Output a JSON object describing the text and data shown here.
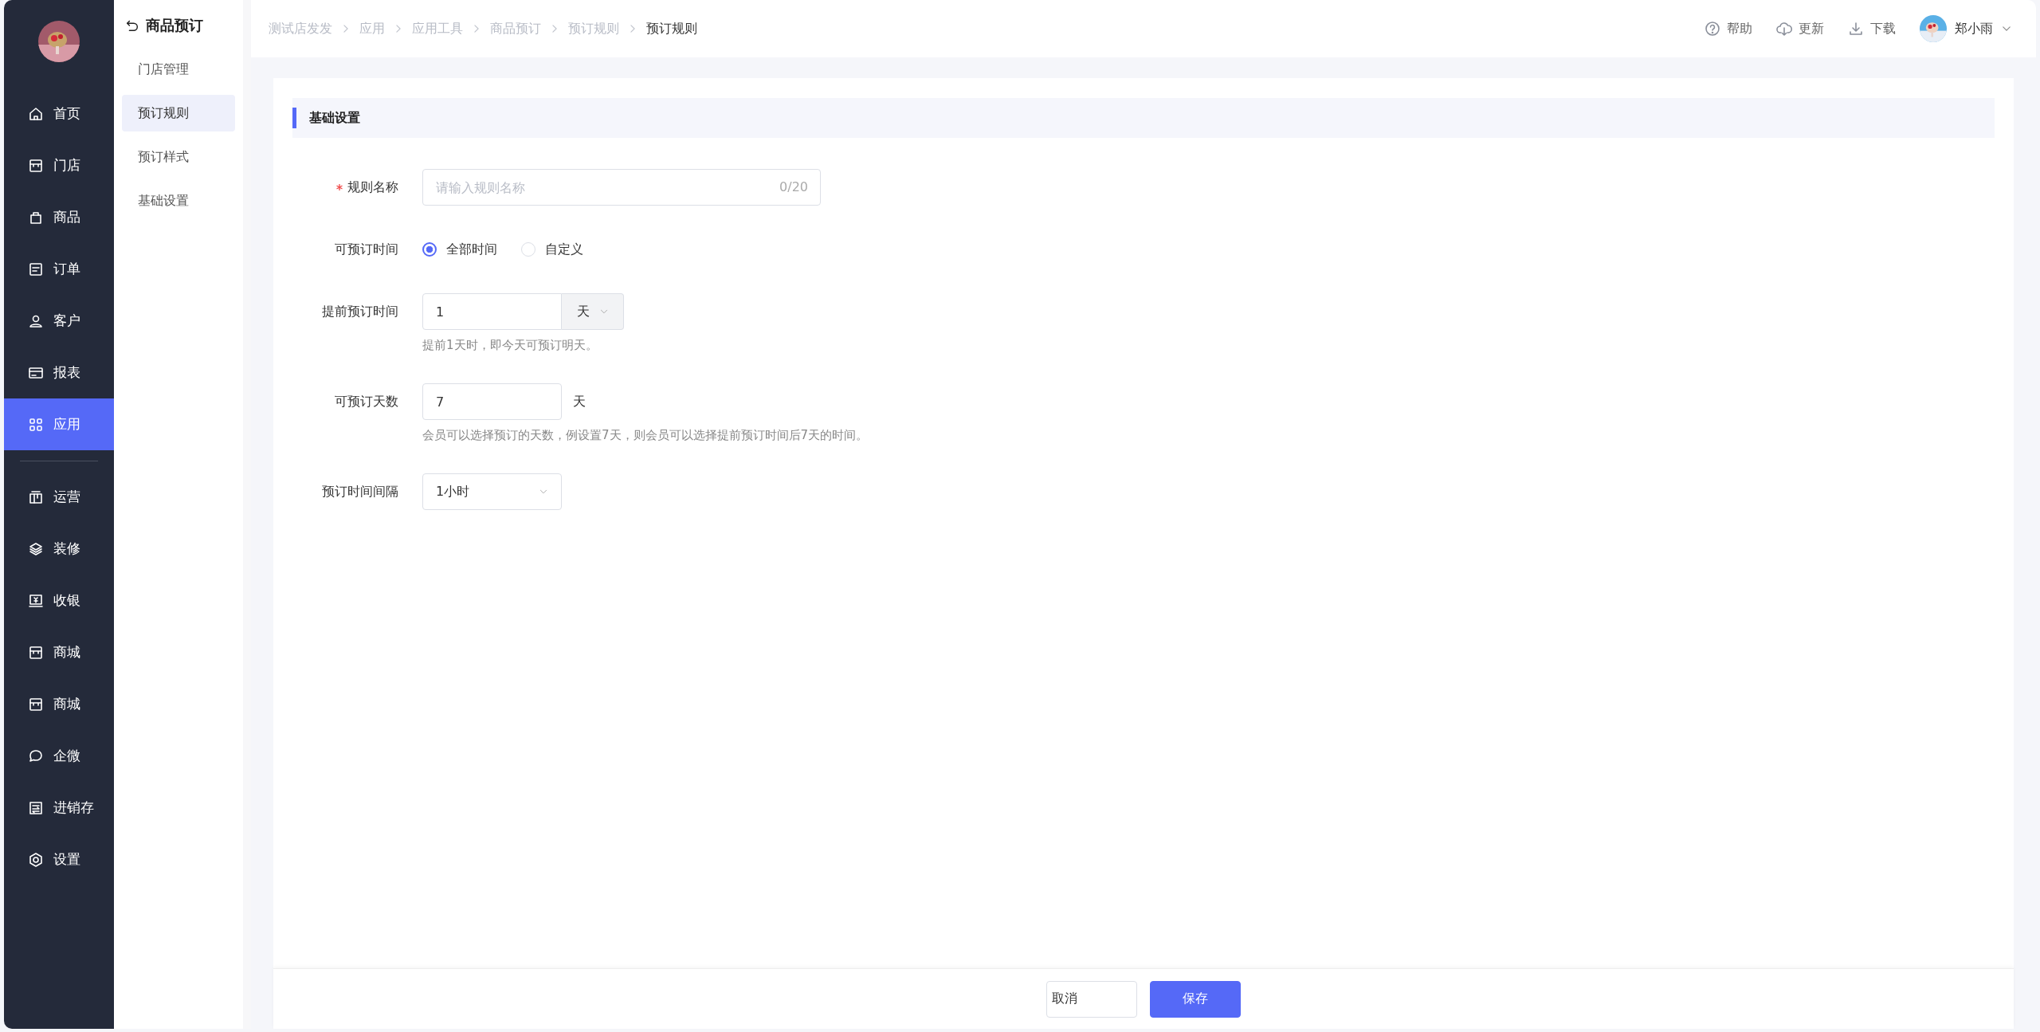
{
  "nav": [
    {
      "label": "首页",
      "selected": false
    },
    {
      "label": "门店",
      "selected": false
    },
    {
      "label": "商品",
      "selected": false
    },
    {
      "label": "订单",
      "selected": false
    },
    {
      "label": "客户",
      "selected": false
    },
    {
      "label": "报表",
      "selected": false
    },
    {
      "label": "应用",
      "selected": true
    }
  ],
  "nav_more": [
    {
      "label": "运营",
      "selected": false
    },
    {
      "label": "装修",
      "selected": false
    },
    {
      "label": "收银",
      "selected": false
    },
    {
      "label": "商城",
      "selected": false
    },
    {
      "label": "商城",
      "selected": false
    },
    {
      "label": "企微",
      "selected": false
    },
    {
      "label": "进销存",
      "selected": false
    },
    {
      "label": "设置",
      "selected": false
    }
  ],
  "subnav": {
    "title": "商品预订",
    "items": [
      {
        "label": "门店管理",
        "selected": false
      },
      {
        "label": "预订规则",
        "selected": true
      },
      {
        "label": "预订样式",
        "selected": false
      },
      {
        "label": "基础设置",
        "selected": false
      }
    ]
  },
  "breadcrumb": [
    "测试店发发",
    "应用",
    "应用工具",
    "商品预订",
    "预订规则",
    "预订规则"
  ],
  "header_actions": [
    "帮助",
    "更新",
    "下载"
  ],
  "user": {
    "name": "郑小雨"
  },
  "section": {
    "title": "基础设置"
  },
  "form": {
    "rule_name": {
      "label": "规则名称",
      "required": true,
      "placeholder": "请输入规则名称",
      "counter": "0/20"
    },
    "bookable_time": {
      "label": "可预订时间",
      "options": [
        {
          "label": "全部时间",
          "selected": true
        },
        {
          "label": "自定义",
          "selected": false
        }
      ]
    },
    "advance_time": {
      "label": "提前预订时间",
      "value": "1",
      "unit": "天",
      "hint": "提前1天时，即今天可预订明天。"
    },
    "bookable_days": {
      "label": "可预订天数",
      "value": "7",
      "unit": "天",
      "hint": "会员可以选择预订的天数，例设置7天，则会员可以选择提前预订时间后7天的时间。"
    },
    "interval": {
      "label": "预订时间间隔",
      "value": "1小时"
    }
  },
  "buttons": [
    {
      "label": "取消",
      "kind": "secondary"
    },
    {
      "label": "保存",
      "kind": "primary"
    }
  ]
}
